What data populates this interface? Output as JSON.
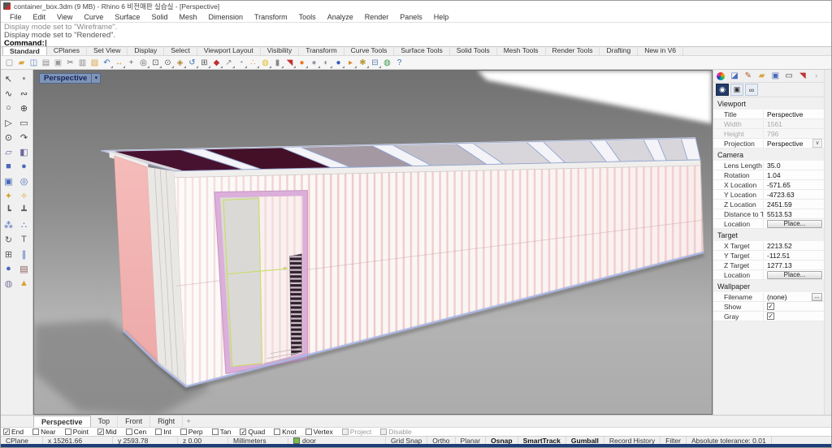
{
  "window": {
    "title": "container_box.3dm (9 MB) - Rhino 6 비전매판 실습실 - [Perspective]"
  },
  "menu": {
    "items": [
      "File",
      "Edit",
      "View",
      "Curve",
      "Surface",
      "Solid",
      "Mesh",
      "Dimension",
      "Transform",
      "Tools",
      "Analyze",
      "Render",
      "Panels",
      "Help"
    ]
  },
  "command": {
    "history": [
      "Display mode set to \"Wireframe\".",
      "Display mode set to \"Rendered\"."
    ],
    "prompt": "Command:"
  },
  "toolbar_tabs": {
    "active": "Standard",
    "items": [
      "Standard",
      "CPlanes",
      "Set View",
      "Display",
      "Select",
      "Viewport Layout",
      "Visibility",
      "Transform",
      "Curve Tools",
      "Surface Tools",
      "Solid Tools",
      "Mesh Tools",
      "Render Tools",
      "Drafting",
      "New in V6"
    ]
  },
  "toolbar": {
    "icons": [
      [
        "new-file",
        "▢",
        "#8a8a8a",
        0
      ],
      [
        "open-file",
        "▰",
        "#d9a441",
        0
      ],
      [
        "save",
        "◫",
        "#5a7ab5",
        0
      ],
      [
        "print",
        "▤",
        "#8a8a8a",
        0
      ],
      [
        "copy-to-clipboard",
        "▣",
        "#9a9a9a",
        0
      ],
      [
        "cut",
        "✂",
        "#6a6a6a",
        0
      ],
      [
        "copy",
        "▥",
        "#8a8a8a",
        0
      ],
      [
        "paste",
        "▨",
        "#d9a441",
        0
      ],
      [
        "undo",
        "↶",
        "#3a6ab5",
        1
      ],
      [
        "pan",
        "↔",
        "#caa43a",
        1
      ],
      [
        "move",
        "+",
        "#6a6a6a",
        0
      ],
      [
        "zoom",
        "◎",
        "#5a5a5a",
        1
      ],
      [
        "zoom-window",
        "⊡",
        "#5a5a5a",
        1
      ],
      [
        "zoom-dynamic",
        "⊙",
        "#5a5a5a",
        1
      ],
      [
        "zoom-extents",
        "◈",
        "#b5883a",
        1
      ],
      [
        "undo-view",
        "↺",
        "#3a6ab5",
        1
      ],
      [
        "four-viewports",
        "⊞",
        "#5a5a5a",
        1
      ],
      [
        "render-car",
        "◆",
        "#c03030",
        1
      ],
      [
        "distance",
        "↗",
        "#8a8a8a",
        1
      ],
      [
        "angle",
        "◔",
        "#8a8a8a",
        1
      ],
      [
        "point-cloud",
        "∴",
        "#d98a2a",
        1
      ],
      [
        "lamp",
        "◍",
        "#e0bb2a",
        1
      ],
      [
        "lock",
        "▮",
        "#888888",
        1
      ],
      [
        "render",
        "◥",
        "#c03030",
        1
      ],
      [
        "render-preview",
        "●",
        "#e87820",
        1
      ],
      [
        "shaded-sphere",
        "●",
        "#9a9aa8",
        1
      ],
      [
        "ghosted-sphere",
        "◐",
        "#8888a0",
        1
      ],
      [
        "rendered-sphere",
        "●",
        "#3a5ab8",
        1
      ],
      [
        "tools-flag",
        "▸",
        "#d98a2a",
        1
      ],
      [
        "options-gear",
        "✱",
        "#b89a3a",
        1
      ],
      [
        "layout-manager",
        "⊟",
        "#5a7ab5",
        1
      ],
      [
        "earth",
        "◍",
        "#3a9a4a",
        0
      ],
      [
        "help",
        "?",
        "#3a6ab5",
        0
      ]
    ]
  },
  "left_toolbar": {
    "icons": [
      [
        "select-pointer",
        "↖",
        "#3a3a3a"
      ],
      [
        "select-point",
        "▪",
        "#888888"
      ],
      [
        "control-point-curve",
        "∿",
        "#3a3a3a"
      ],
      [
        "interpolate-curve",
        "∾",
        "#3a3a3a"
      ],
      [
        "circle",
        "○",
        "#3a3a3a"
      ],
      [
        "ellipse",
        "⊕",
        "#3a3a3a"
      ],
      [
        "polygon",
        "▷",
        "#3a3a3a"
      ],
      [
        "rectangle",
        "▭",
        "#3a3a3a"
      ],
      [
        "point",
        "⊙",
        "#3a3a3a"
      ],
      [
        "curve-tools",
        "↷",
        "#3a3a3a"
      ],
      [
        "surface-plane",
        "▱",
        "#6a6a9a"
      ],
      [
        "surface-patch",
        "◧",
        "#6a6a9a"
      ],
      [
        "box",
        "■",
        "#4a6ab8"
      ],
      [
        "sphere",
        "●",
        "#4a6ab8"
      ],
      [
        "rounded-box",
        "▣",
        "#4a6ab8"
      ],
      [
        "torus",
        "◎",
        "#4a6ab8"
      ],
      [
        "boolean-union",
        "✦",
        "#d9a12a"
      ],
      [
        "boolean-difference",
        "✧",
        "#d9a12a"
      ],
      [
        "fillet-edge",
        "┗",
        "#5a5a5a"
      ],
      [
        "chamfer-edge",
        "┻",
        "#5a5a5a"
      ],
      [
        "explode",
        "⁂",
        "#4a6ab8"
      ],
      [
        "join",
        "∴",
        "#4a6ab8"
      ],
      [
        "rotate",
        "↻",
        "#5a5a5a"
      ],
      [
        "text",
        "T",
        "#5a5a5a"
      ],
      [
        "block",
        "⊞",
        "#5a5a5a"
      ],
      [
        "array",
        "∥",
        "#4a6ab8"
      ],
      [
        "layer-disk",
        "●",
        "#4a6ab8"
      ],
      [
        "stack",
        "▤",
        "#8a5a5a"
      ],
      [
        "visibility",
        "◍",
        "#7a7a9a"
      ],
      [
        "shade",
        "▲",
        "#d9a12a"
      ]
    ]
  },
  "viewport": {
    "label": "Perspective",
    "dropdown_glyph": "▾",
    "tabs": [
      "Perspective",
      "Top",
      "Front",
      "Right"
    ],
    "active_tab": "Perspective",
    "add_tab_glyph": "+"
  },
  "panel": {
    "tab_icons": [
      [
        "properties-tab",
        "wheel",
        ""
      ],
      [
        "display-tab",
        "◪",
        "#4a6ab8"
      ],
      [
        "materials-tab",
        "✎",
        "#b05a2a"
      ],
      [
        "libraries-tab",
        "▰",
        "#d9a441"
      ],
      [
        "rendering-tab",
        "▣",
        "#4a6ab8"
      ],
      [
        "monitor-tab",
        "▭",
        "#444444"
      ],
      [
        "rhino-help-tab",
        "◥",
        "#c03030"
      ],
      [
        "tabs-scroll",
        "›",
        "#aaaaaa"
      ]
    ],
    "subtabs": [
      [
        "camera-subtab",
        "◉",
        1
      ],
      [
        "viewport-props-subtab",
        "▣",
        0
      ],
      [
        "link-subtab",
        "∞",
        0
      ]
    ],
    "sections": [
      {
        "title": "Viewport",
        "rows": [
          [
            "Title",
            "Perspective",
            ""
          ],
          [
            "Width",
            "1561",
            "muted"
          ],
          [
            "Height",
            "796",
            "muted"
          ],
          [
            "Projection",
            "Perspective",
            "select"
          ]
        ]
      },
      {
        "title": "Camera",
        "rows": [
          [
            "Lens Length",
            "35.0",
            ""
          ],
          [
            "Rotation",
            "1.04",
            ""
          ],
          [
            "X Location",
            "-571.65",
            ""
          ],
          [
            "Y Location",
            "-4723.63",
            ""
          ],
          [
            "Z Location",
            "2451.59",
            ""
          ],
          [
            "Distance to Target",
            "5513.53",
            ""
          ],
          [
            "Location",
            "Place...",
            "button"
          ]
        ]
      },
      {
        "title": "Target",
        "rows": [
          [
            "X Target",
            "2213.52",
            ""
          ],
          [
            "Y Target",
            "-112.51",
            ""
          ],
          [
            "Z Target",
            "1277.13",
            ""
          ],
          [
            "Location",
            "Place...",
            "button"
          ]
        ]
      },
      {
        "title": "Wallpaper",
        "rows": [
          [
            "Filename",
            "(none)",
            "file"
          ],
          [
            "Show",
            "true",
            "check"
          ],
          [
            "Gray",
            "true",
            "check"
          ]
        ]
      }
    ]
  },
  "osnap": {
    "items": [
      [
        "End",
        1,
        0
      ],
      [
        "Near",
        0,
        0
      ],
      [
        "Point",
        0,
        0
      ],
      [
        "Mid",
        1,
        0
      ],
      [
        "Cen",
        0,
        0
      ],
      [
        "Int",
        0,
        0
      ],
      [
        "Perp",
        0,
        0
      ],
      [
        "Tan",
        0,
        0
      ],
      [
        "Quad",
        1,
        0
      ],
      [
        "Knot",
        0,
        0
      ],
      [
        "Vertex",
        0,
        0
      ],
      [
        "Project",
        0,
        1
      ],
      [
        "Disable",
        0,
        1
      ]
    ]
  },
  "status": {
    "layer_color": "#76c043",
    "cells": [
      [
        "CPlane",
        0,
        "",
        52
      ],
      [
        "x 15261.66",
        0,
        "",
        86
      ],
      [
        "y 2593.78",
        0,
        "",
        80
      ],
      [
        "z 0.00",
        0,
        "",
        62
      ],
      [
        "Millimeters",
        0,
        "",
        74
      ],
      [
        "door",
        0,
        "swatch",
        120
      ],
      [
        "Grid Snap",
        0,
        "",
        0
      ],
      [
        "Ortho",
        0,
        "",
        0
      ],
      [
        "Planar",
        0,
        "",
        0
      ],
      [
        "Osnap",
        1,
        "",
        0
      ],
      [
        "SmartTrack",
        1,
        "",
        0
      ],
      [
        "Gumball",
        1,
        "",
        0
      ],
      [
        "Record History",
        0,
        "",
        0
      ],
      [
        "Filter",
        0,
        "",
        0
      ],
      [
        "Absolute tolerance: 0.01",
        0,
        "",
        0
      ]
    ]
  }
}
